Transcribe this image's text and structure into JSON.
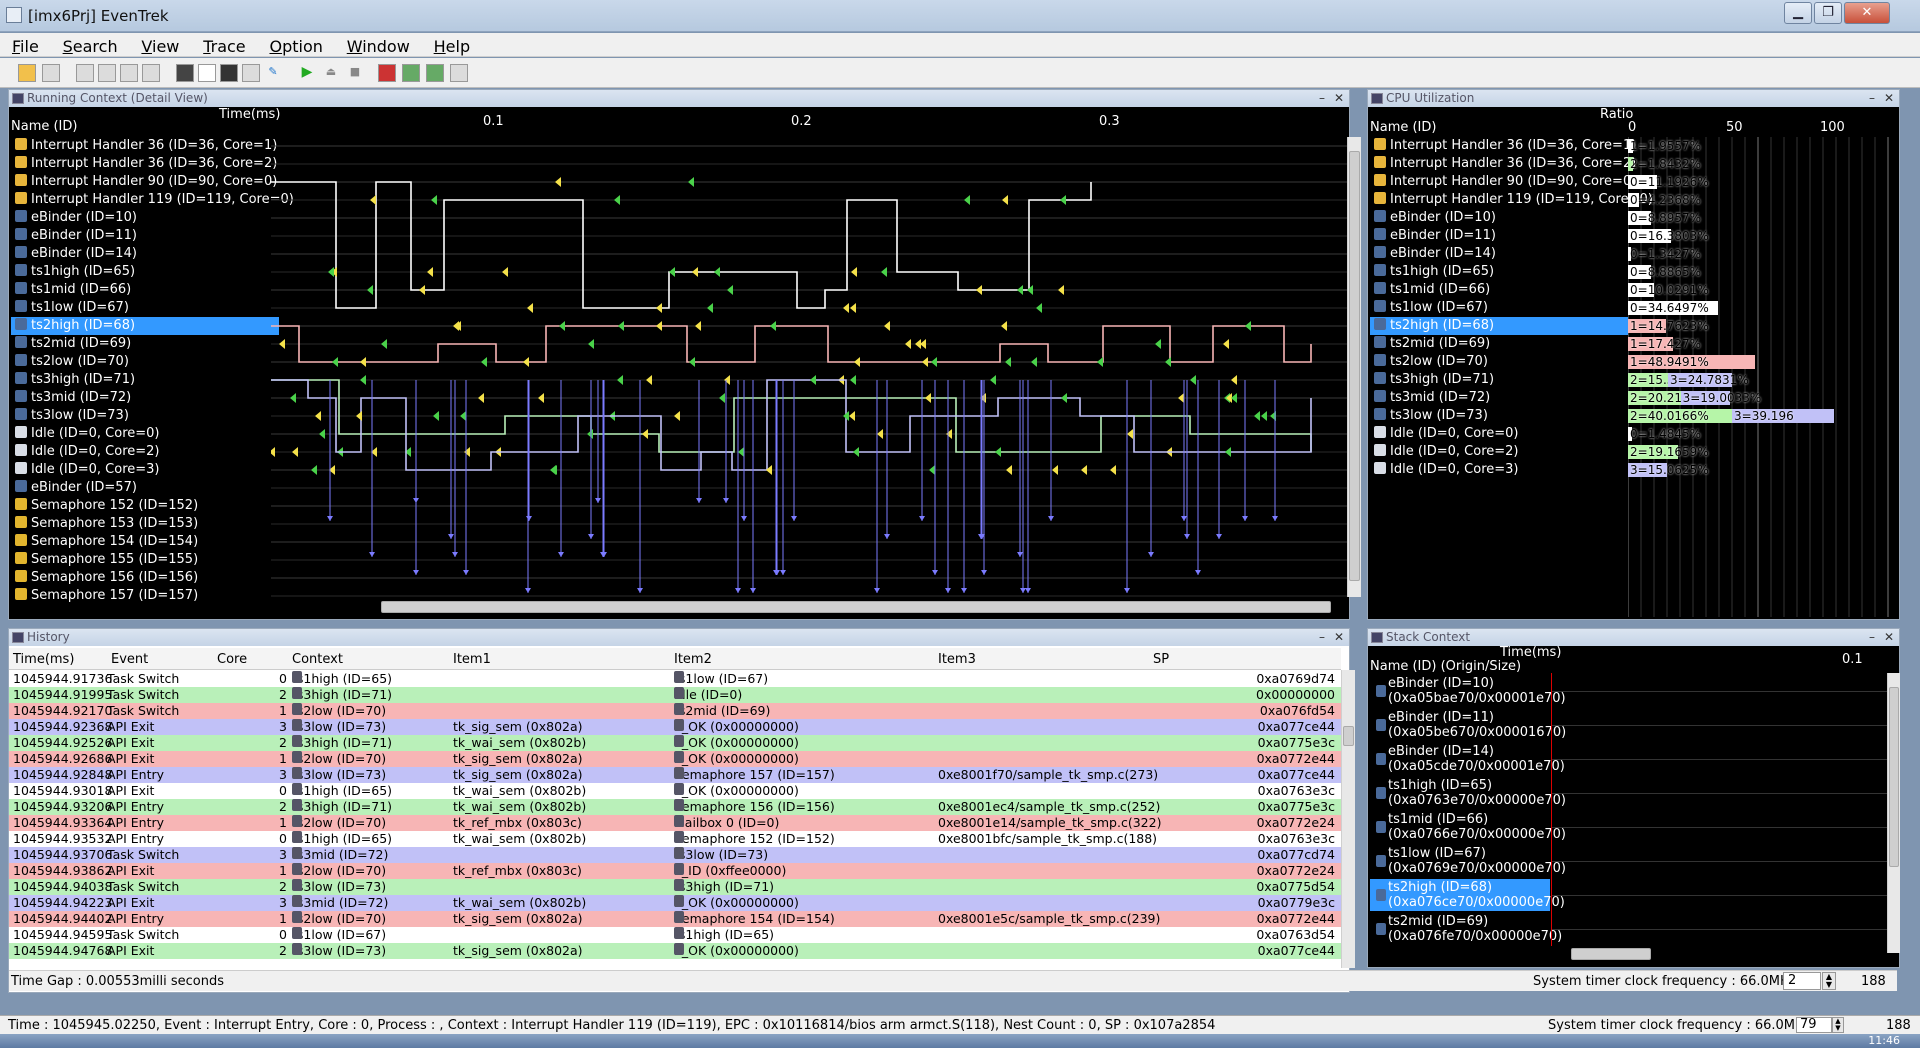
{
  "window": {
    "title": "[imx6Prj] EvenTrek"
  },
  "menu": [
    "File",
    "Search",
    "View",
    "Trace",
    "Option",
    "Window",
    "Help"
  ],
  "running": {
    "title": "Running Context (Detail View)",
    "name_header": "Name (ID)",
    "time_header": "Time(ms)",
    "ticks": [
      "0.1",
      "0.2",
      "0.3"
    ],
    "rows": [
      {
        "label": "Interrupt Handler 36 (ID=36, Core=1)",
        "icon": "interrupt-icon"
      },
      {
        "label": "Interrupt Handler 36 (ID=36, Core=2)",
        "icon": "interrupt-icon"
      },
      {
        "label": "Interrupt Handler 90 (ID=90, Core=0)",
        "icon": "interrupt-icon"
      },
      {
        "label": "Interrupt Handler 119 (ID=119, Core=0)",
        "icon": "interrupt-icon"
      },
      {
        "label": "eBinder (ID=10)",
        "icon": "task-icon"
      },
      {
        "label": "eBinder (ID=11)",
        "icon": "task-icon"
      },
      {
        "label": "eBinder (ID=14)",
        "icon": "task-icon"
      },
      {
        "label": "ts1high (ID=65)",
        "icon": "task-icon"
      },
      {
        "label": "ts1mid (ID=66)",
        "icon": "task-icon"
      },
      {
        "label": "ts1low (ID=67)",
        "icon": "task-icon"
      },
      {
        "label": "ts2high (ID=68)",
        "icon": "task-icon"
      },
      {
        "label": "ts2mid (ID=69)",
        "icon": "task-icon"
      },
      {
        "label": "ts2low (ID=70)",
        "icon": "task-icon"
      },
      {
        "label": "ts3high (ID=71)",
        "icon": "task-icon"
      },
      {
        "label": "ts3mid (ID=72)",
        "icon": "task-icon"
      },
      {
        "label": "ts3low (ID=73)",
        "icon": "task-icon"
      },
      {
        "label": "Idle (ID=0, Core=0)",
        "icon": "idle-icon"
      },
      {
        "label": "Idle (ID=0, Core=2)",
        "icon": "idle-icon"
      },
      {
        "label": "Idle (ID=0, Core=3)",
        "icon": "idle-icon"
      },
      {
        "label": "eBinder (ID=57)",
        "icon": "task-icon"
      },
      {
        "label": "Semaphore 152 (ID=152)",
        "icon": "semaphore-icon"
      },
      {
        "label": "Semaphore 153 (ID=153)",
        "icon": "semaphore-icon"
      },
      {
        "label": "Semaphore 154 (ID=154)",
        "icon": "semaphore-icon"
      },
      {
        "label": "Semaphore 155 (ID=155)",
        "icon": "semaphore-icon"
      },
      {
        "label": "Semaphore 156 (ID=156)",
        "icon": "semaphore-icon"
      },
      {
        "label": "Semaphore 157 (ID=157)",
        "icon": "semaphore-icon"
      }
    ],
    "selected_row": 10
  },
  "cpu": {
    "title": "CPU Utilization",
    "name_header": "Name (ID)",
    "ratio_header": "Ratio",
    "scale": [
      "0",
      "50",
      "100"
    ],
    "rows": [
      {
        "label": "Interrupt Handler 36 (ID=36, Core=1)",
        "icon": "interrupt-icon",
        "bars": [
          {
            "core": "1",
            "text": "1=1.9557%",
            "pct": 1.9557,
            "color": "#ffffff"
          }
        ]
      },
      {
        "label": "Interrupt Handler 36 (ID=36, Core=2)",
        "icon": "interrupt-icon",
        "bars": [
          {
            "text": "2=1.8432%",
            "pct": 1.8432,
            "color": "#b6f5a8"
          }
        ]
      },
      {
        "label": "Interrupt Handler 90 (ID=90, Core=0)",
        "icon": "interrupt-icon",
        "bars": [
          {
            "text": "0=11.1926%",
            "pct": 11.1926,
            "color": "#ffffff"
          }
        ]
      },
      {
        "label": "Interrupt Handler 119 (ID=119, Core=0)",
        "icon": "interrupt-icon",
        "bars": [
          {
            "text": "0=4.2368%",
            "pct": 4.2368,
            "color": "#ffffff"
          }
        ]
      },
      {
        "label": "eBinder (ID=10)",
        "icon": "task-icon",
        "bars": [
          {
            "text": "0=8.8957%",
            "pct": 8.8957,
            "color": "#ffffff"
          }
        ]
      },
      {
        "label": "eBinder (ID=11)",
        "icon": "task-icon",
        "bars": [
          {
            "text": "0=16.3803%",
            "pct": 16.3803,
            "color": "#ffffff"
          }
        ]
      },
      {
        "label": "eBinder (ID=14)",
        "icon": "task-icon",
        "bars": [
          {
            "text": "0=1.3427%",
            "pct": 1.3427,
            "color": "#ffffff"
          }
        ]
      },
      {
        "label": "ts1high (ID=65)",
        "icon": "task-icon",
        "bars": [
          {
            "text": "0=8.8865%",
            "pct": 8.8865,
            "color": "#ffffff"
          }
        ]
      },
      {
        "label": "ts1mid (ID=66)",
        "icon": "task-icon",
        "bars": [
          {
            "text": "0=10.0291%",
            "pct": 10.0291,
            "color": "#ffffff"
          }
        ]
      },
      {
        "label": "ts1low (ID=67)",
        "icon": "task-icon",
        "bars": [
          {
            "text": "0=34.6497%",
            "pct": 34.6497,
            "color": "#ffffff"
          }
        ]
      },
      {
        "label": "ts2high (ID=68)",
        "icon": "task-icon",
        "bars": [
          {
            "text": "1=14.7623%",
            "pct": 14.7623,
            "color": "#f7b5b5"
          }
        ]
      },
      {
        "label": "ts2mid (ID=69)",
        "icon": "task-icon",
        "bars": [
          {
            "text": "1=17.427%",
            "pct": 17.427,
            "color": "#f7b5b5"
          }
        ]
      },
      {
        "label": "ts2low (ID=70)",
        "icon": "task-icon",
        "bars": [
          {
            "text": "1=48.9491%",
            "pct": 48.9491,
            "color": "#f7b5b5"
          }
        ]
      },
      {
        "label": "ts3high (ID=71)",
        "icon": "task-icon",
        "bars": [
          {
            "text": "2=15.3919%",
            "pct": 15.3919,
            "color": "#b6f5a8"
          },
          {
            "text": "3=24.7831%",
            "pct": 24.7831,
            "color": "#c1c1f7"
          }
        ]
      },
      {
        "label": "ts3mid (ID=72)",
        "icon": "task-icon",
        "bars": [
          {
            "text": "2=20.2168%",
            "pct": 20.2168,
            "color": "#b6f5a8"
          },
          {
            "text": "3=19.0033%",
            "pct": 19.0033,
            "color": "#c1c1f7"
          }
        ]
      },
      {
        "label": "ts3low (ID=73)",
        "icon": "task-icon",
        "bars": [
          {
            "text": "2=40.0166%",
            "pct": 40.0166,
            "color": "#b6f5a8"
          },
          {
            "text": "3=39.196",
            "pct": 39.196,
            "color": "#c1c1f7"
          }
        ]
      },
      {
        "label": "Idle (ID=0, Core=0)",
        "icon": "idle-icon",
        "bars": [
          {
            "text": "0=1.4845%",
            "pct": 1.4845,
            "color": "#ffffff"
          }
        ]
      },
      {
        "label": "Idle (ID=0, Core=2)",
        "icon": "idle-icon",
        "bars": [
          {
            "text": "2=19.1659%",
            "pct": 19.1659,
            "color": "#b6f5a8"
          }
        ]
      },
      {
        "label": "Idle (ID=0, Core=3)",
        "icon": "idle-icon",
        "bars": [
          {
            "text": "3=15.0625%",
            "pct": 15.0625,
            "color": "#c1c1f7"
          }
        ]
      }
    ],
    "selected_row": 10
  },
  "history": {
    "title": "History",
    "columns": [
      "Time(ms)",
      "Event",
      "Core",
      "Context",
      "Item1",
      "Item2",
      "Item3",
      "SP"
    ],
    "rows": [
      {
        "time": "1045944.91736",
        "event": "Task Switch",
        "core": "0",
        "context": "ts1high (ID=65)",
        "item1": "",
        "item2": "ts1low (ID=67)",
        "item3": "",
        "sp": "0xa0769d74"
      },
      {
        "time": "1045944.91995",
        "event": "Task Switch",
        "core": "2",
        "context": "ts3high (ID=71)",
        "item1": "",
        "item2": "Idle (ID=0)",
        "item3": "",
        "sp": "0x00000000"
      },
      {
        "time": "1045944.92170",
        "event": "Task Switch",
        "core": "1",
        "context": "ts2low (ID=70)",
        "item1": "",
        "item2": "ts2mid (ID=69)",
        "item3": "",
        "sp": "0xa076fd54"
      },
      {
        "time": "1045944.92368",
        "event": "API Exit",
        "core": "3",
        "context": "ts3low (ID=73)",
        "item1": "tk_sig_sem (0x802a)",
        "item2": "E_OK (0x00000000)",
        "item3": "",
        "sp": "0xa077ce44"
      },
      {
        "time": "1045944.92526",
        "event": "API Exit",
        "core": "2",
        "context": "ts3high (ID=71)",
        "item1": "tk_wai_sem (0x802b)",
        "item2": "E_OK (0x00000000)",
        "item3": "",
        "sp": "0xa0775e3c"
      },
      {
        "time": "1045944.92686",
        "event": "API Exit",
        "core": "1",
        "context": "ts2low (ID=70)",
        "item1": "tk_sig_sem (0x802a)",
        "item2": "E_OK (0x00000000)",
        "item3": "",
        "sp": "0xa0772e44"
      },
      {
        "time": "1045944.92848",
        "event": "API Entry",
        "core": "3",
        "context": "ts3low (ID=73)",
        "item1": "tk_sig_sem (0x802a)",
        "item2": "Semaphore 157 (ID=157)",
        "item3": "0xe8001f70/sample_tk_smp.c(273)",
        "sp": "0xa077ce44"
      },
      {
        "time": "1045944.93018",
        "event": "API Exit",
        "core": "0",
        "context": "ts1high (ID=65)",
        "item1": "tk_wai_sem (0x802b)",
        "item2": "E_OK (0x00000000)",
        "item3": "",
        "sp": "0xa0763e3c"
      },
      {
        "time": "1045944.93206",
        "event": "API Entry",
        "core": "2",
        "context": "ts3high (ID=71)",
        "item1": "tk_wai_sem (0x802b)",
        "item2": "Semaphore 156 (ID=156)",
        "item3": "0xe8001ec4/sample_tk_smp.c(252)",
        "sp": "0xa0775e3c"
      },
      {
        "time": "1045944.93364",
        "event": "API Entry",
        "core": "1",
        "context": "ts2low (ID=70)",
        "item1": "tk_ref_mbx (0x803c)",
        "item2": "Mailbox 0 (ID=0)",
        "item3": "0xe8001e14/sample_tk_smp.c(322)",
        "sp": "0xa0772e24"
      },
      {
        "time": "1045944.93532",
        "event": "API Entry",
        "core": "0",
        "context": "ts1high (ID=65)",
        "item1": "tk_wai_sem (0x802b)",
        "item2": "Semaphore 152 (ID=152)",
        "item3": "0xe8001bfc/sample_tk_smp.c(188)",
        "sp": "0xa0763e3c"
      },
      {
        "time": "1045944.93706",
        "event": "Task Switch",
        "core": "3",
        "context": "ts3mid (ID=72)",
        "item1": "",
        "item2": "ts3low (ID=73)",
        "item3": "",
        "sp": "0xa077cd74"
      },
      {
        "time": "1045944.93862",
        "event": "API Exit",
        "core": "1",
        "context": "ts2low (ID=70)",
        "item1": "tk_ref_mbx (0x803c)",
        "item2": "E_ID (0xffee0000)",
        "item3": "",
        "sp": "0xa0772e24"
      },
      {
        "time": "1045944.94038",
        "event": "Task Switch",
        "core": "2",
        "context": "ts3low (ID=73)",
        "item1": "",
        "item2": "ts3high (ID=71)",
        "item3": "",
        "sp": "0xa0775d54"
      },
      {
        "time": "1045944.94223",
        "event": "API Exit",
        "core": "3",
        "context": "ts3mid (ID=72)",
        "item1": "tk_wai_sem (0x802b)",
        "item2": "E_OK (0x00000000)",
        "item3": "",
        "sp": "0xa0779e3c"
      },
      {
        "time": "1045944.94402",
        "event": "API Entry",
        "core": "1",
        "context": "ts2low (ID=70)",
        "item1": "tk_sig_sem (0x802a)",
        "item2": "Semaphore 154 (ID=154)",
        "item3": "0xe8001e5c/sample_tk_smp.c(239)",
        "sp": "0xa0772e44"
      },
      {
        "time": "1045944.94595",
        "event": "Task Switch",
        "core": "0",
        "context": "ts1low (ID=67)",
        "item1": "",
        "item2": "ts1high (ID=65)",
        "item3": "",
        "sp": "0xa0763d54"
      },
      {
        "time": "1045944.94768",
        "event": "API Exit",
        "core": "2",
        "context": "ts3low (ID=73)",
        "item1": "tk_sig_sem (0x802a)",
        "item2": "E_OK (0x00000000)",
        "item3": "",
        "sp": "0xa077ce44"
      }
    ],
    "time_gap": "Time Gap : 0.00553milli seconds",
    "sys_timer": "System timer clock frequency : 66.0MHz",
    "spin_value": "2",
    "count": "188"
  },
  "stack": {
    "title": "Stack Context",
    "name_header": "Name (ID) (Origin/Size)",
    "time_header": "Time(ms)",
    "tick": "0.1",
    "rows": [
      {
        "name": "eBinder (ID=10)",
        "origin": "(0xa05bae70/0x00001e70)"
      },
      {
        "name": "eBinder (ID=11)",
        "origin": "(0xa05be670/0x00001670)"
      },
      {
        "name": "eBinder (ID=14)",
        "origin": "(0xa05cde70/0x00001e70)"
      },
      {
        "name": "ts1high (ID=65)",
        "origin": "(0xa0763e70/0x00000e70)"
      },
      {
        "name": "ts1mid (ID=66)",
        "origin": "(0xa0766e70/0x00000e70)"
      },
      {
        "name": "ts1low (ID=67)",
        "origin": "(0xa0769e70/0x00000e70)"
      },
      {
        "name": "ts2high (ID=68)",
        "origin": "(0xa076ce70/0x00000e70)"
      },
      {
        "name": "ts2mid (ID=69)",
        "origin": "(0xa076fe70/0x00000e70)"
      }
    ],
    "selected_row": 6
  },
  "status": {
    "text": "Time : 1045945.02250, Event : Interrupt Entry, Core : 0, Process : , Context : Interrupt Handler 119 (ID=119), EPC : 0x10116814/bios arm armct.S(118), Nest Count : 0, SP : 0x107a2854",
    "sys_timer": "System timer clock frequency : 66.0MHz",
    "spin_value": "79",
    "count": "188"
  },
  "taskbar": {
    "time": "11:46"
  },
  "colors": {
    "core0": "#ffffff",
    "core1": "#f7b5b5",
    "core2": "#b9f0b9",
    "core3": "#c1c1f7",
    "selection": "#3399ff"
  }
}
